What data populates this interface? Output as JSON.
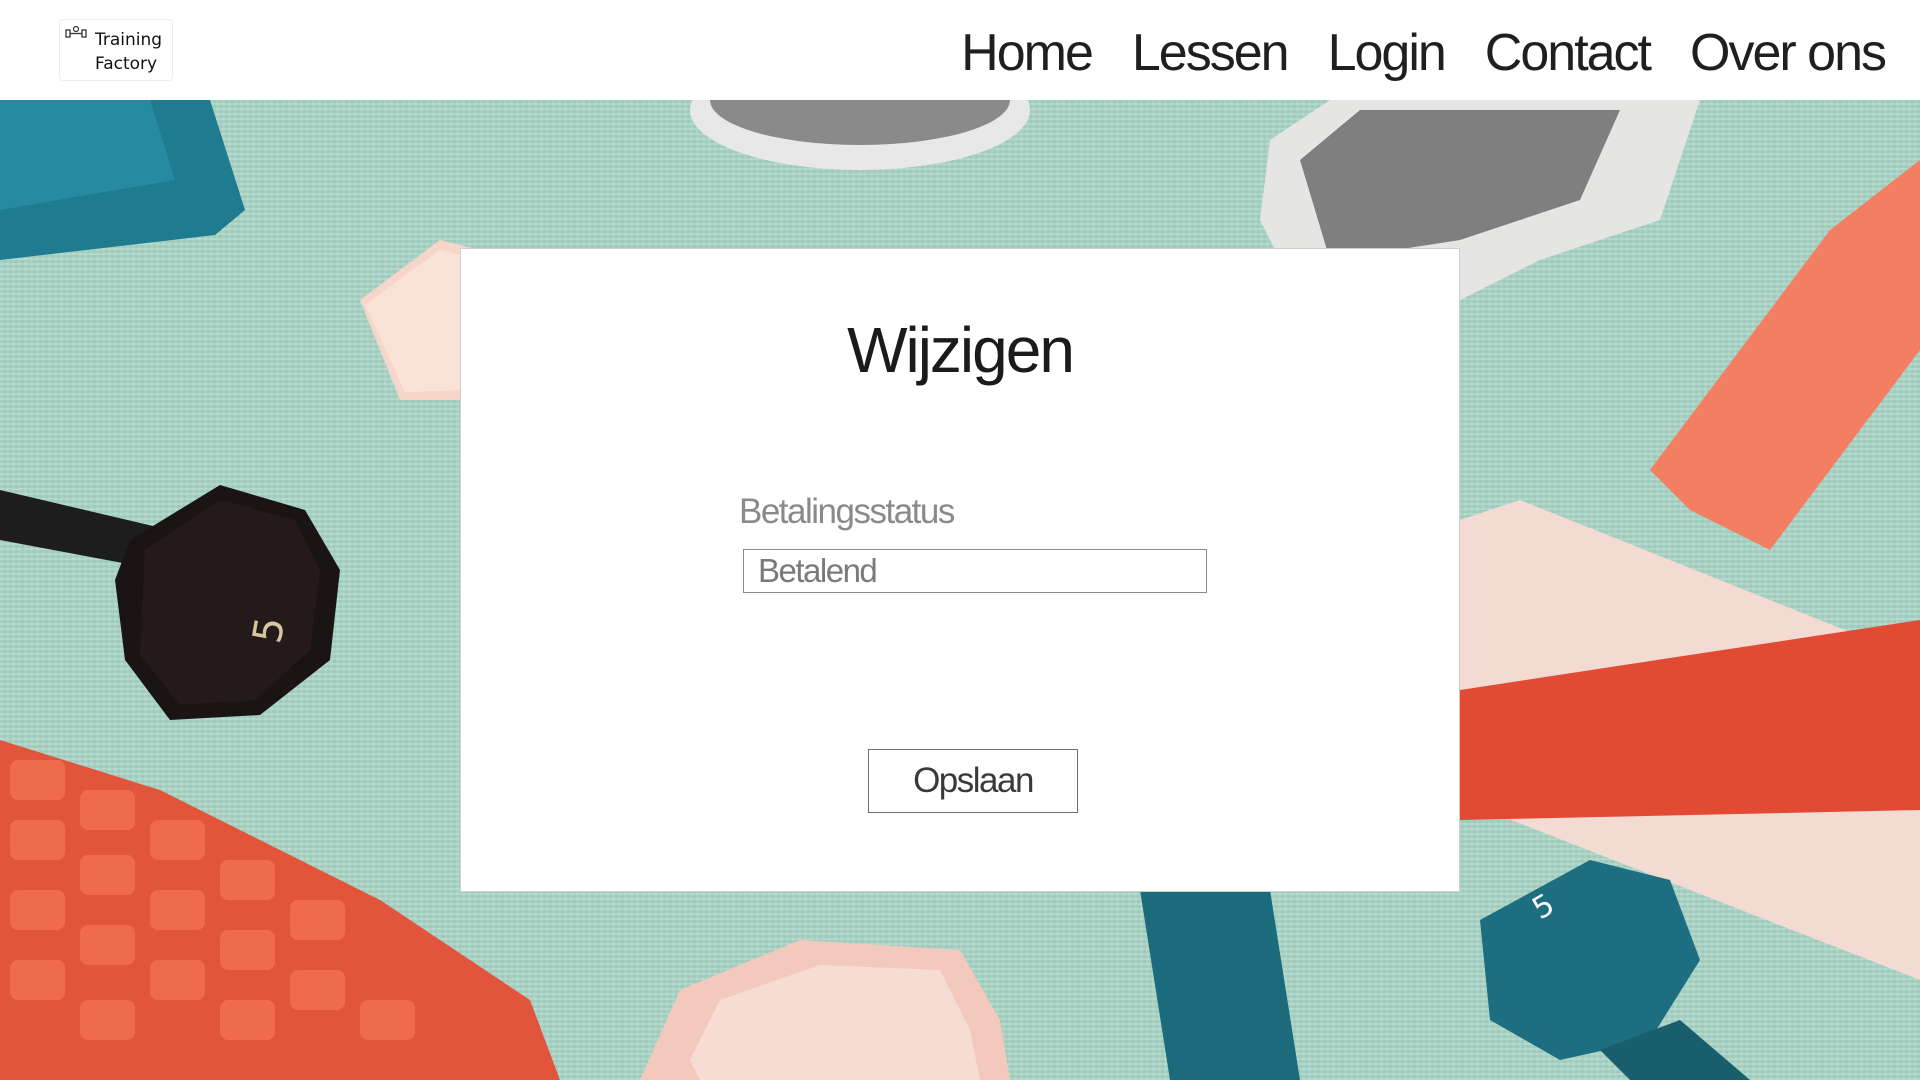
{
  "brand": {
    "line1": "Training",
    "line2": "Factory",
    "icon": "dumbbell-icon"
  },
  "nav": [
    {
      "label": "Home"
    },
    {
      "label": "Lessen"
    },
    {
      "label": "Login"
    },
    {
      "label": "Contact"
    },
    {
      "label": "Over ons"
    }
  ],
  "form": {
    "title": "Wijzigen",
    "field_label": "Betalingsstatus",
    "field_value": "Betalend",
    "submit_label": "Opslaan"
  },
  "background": {
    "description_colors": {
      "mat": "#a8d5c6",
      "accent_orange": "#e8503a",
      "teal": "#1f6f7f",
      "pink": "#f4d3c7"
    }
  }
}
